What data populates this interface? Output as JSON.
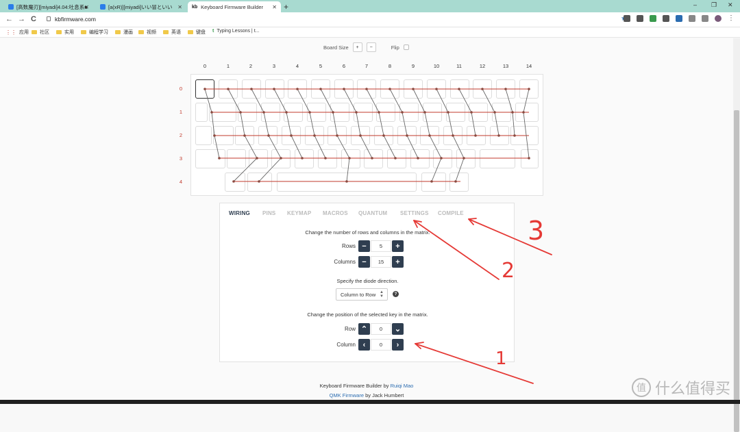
{
  "browser": {
    "tabs": [
      {
        "label": "[高数魔刃][miyadi]4.04:吐息系■"
      },
      {
        "label": "[a(xR)][miyadi]いい冒といい"
      },
      {
        "label": "Keyboard Firmware Builder",
        "badge": "kb"
      }
    ],
    "new_tab": "+",
    "url": "kbfirmware.com",
    "nav": {
      "back": "←",
      "forward": "→",
      "reload": "C"
    },
    "window": {
      "minimize": "–",
      "maximize": "❐",
      "close": "✕"
    },
    "bookmarks": [
      "应用",
      "社区",
      "实用",
      "编程学习",
      "漫画",
      "视频",
      "英语",
      "键盘",
      "Typing Lessons | t..."
    ]
  },
  "toolbar": {
    "board_size_label": "Board Size",
    "zoom_in": "+",
    "zoom_out": "−",
    "flip_label": "Flip"
  },
  "matrix": {
    "columns": [
      "0",
      "1",
      "2",
      "3",
      "4",
      "5",
      "6",
      "7",
      "8",
      "9",
      "10",
      "11",
      "12",
      "13",
      "14"
    ],
    "rows": [
      "0",
      "1",
      "2",
      "3",
      "4"
    ],
    "wire_color": "#c0392b",
    "diode_color": "#555555"
  },
  "panel": {
    "tabs": [
      "WIRING",
      "PINS",
      "KEYMAP",
      "MACROS",
      "QUANTUM",
      "SETTINGS",
      "COMPILE"
    ],
    "active_tab": "WIRING",
    "matrix_size_text": "Change the number of rows and columns in the matrix.",
    "rows_label": "Rows",
    "rows_value": "5",
    "columns_label": "Columns",
    "columns_value": "15",
    "diode_text": "Specify the diode direction.",
    "diode_value": "Column to Row",
    "help": "?",
    "position_text": "Change the position of the selected key in the matrix.",
    "row_label": "Row",
    "row_value": "0",
    "column_label": "Column",
    "column_value": "0",
    "minus": "−",
    "plus": "+",
    "up": "⌃",
    "down": "⌄",
    "left": "‹",
    "right": "›"
  },
  "footer": {
    "line1_prefix": "Keyboard Firmware Builder by ",
    "line1_author": "Ruiqi Mao",
    "line2_link": "QMK Firmware",
    "line2_suffix": " by Jack Humbert"
  },
  "annotations": {
    "n1": "1",
    "n2": "2",
    "n3": "3",
    "color": "#e53935"
  },
  "watermark": {
    "icon": "值",
    "text": "什么值得买"
  }
}
